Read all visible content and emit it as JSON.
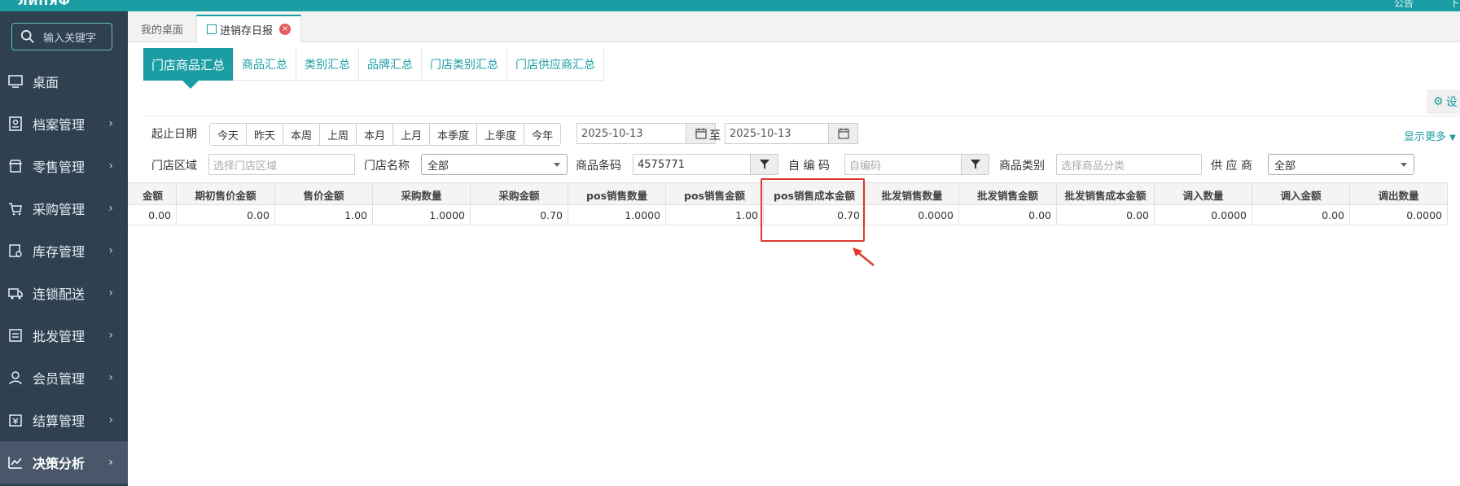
{
  "topbar": {
    "logo_fragment": "ЛИПЯФ",
    "notice": "公告",
    "right_fragment": "下"
  },
  "sidebar": {
    "search_placeholder": "输入关键字",
    "items": [
      {
        "label": "桌面",
        "icon": "desktop-icon",
        "has_arrow": false
      },
      {
        "label": "档案管理",
        "icon": "archive-icon",
        "has_arrow": true
      },
      {
        "label": "零售管理",
        "icon": "shop-icon",
        "has_arrow": true
      },
      {
        "label": "采购管理",
        "icon": "purchase-icon",
        "has_arrow": true
      },
      {
        "label": "库存管理",
        "icon": "inventory-icon",
        "has_arrow": true
      },
      {
        "label": "连锁配送",
        "icon": "delivery-icon",
        "has_arrow": true
      },
      {
        "label": "批发管理",
        "icon": "wholesale-icon",
        "has_arrow": true
      },
      {
        "label": "会员管理",
        "icon": "member-icon",
        "has_arrow": true
      },
      {
        "label": "结算管理",
        "icon": "settlement-icon",
        "has_arrow": true
      },
      {
        "label": "决策分析",
        "icon": "analytics-icon",
        "has_arrow": true,
        "active": true
      }
    ],
    "arrow": "›"
  },
  "tabs": {
    "home": "我的桌面",
    "active": "进销存日报",
    "close": "×"
  },
  "subtabs": [
    "门店商品汇总",
    "商品汇总",
    "类别汇总",
    "品牌汇总",
    "门店类别汇总",
    "门店供应商汇总"
  ],
  "settings_label": "设",
  "filters": {
    "date_label": "起止日期",
    "date_buttons": [
      "今天",
      "昨天",
      "本周",
      "上周",
      "本月",
      "上月",
      "本季度",
      "上季度",
      "今年"
    ],
    "date_from": "2025-10-13",
    "date_to_sep": "至",
    "date_to": "2025-10-13",
    "show_more": "显示更多",
    "region_label": "门店区域",
    "region_placeholder": "选择门店区域",
    "store_label": "门店名称",
    "store_value": "全部",
    "barcode_label": "商品条码",
    "barcode_value": "4575771",
    "selfcode_label": "自 编 码",
    "selfcode_placeholder": "自编码",
    "category_label": "商品类别",
    "category_placeholder": "选择商品分类",
    "supplier_label": "供 应 商",
    "supplier_value": "全部"
  },
  "table": {
    "columns": [
      "金额",
      "期初售价金额",
      "售价金额",
      "采购数量",
      "采购金额",
      "pos销售数量",
      "pos销售金额",
      "pos销售成本金额",
      "批发销售数量",
      "批发销售金额",
      "批发销售成本金额",
      "调入数量",
      "调入金额",
      "调出数量"
    ],
    "row": [
      "0.00",
      "0.00",
      "1.00",
      "1.0000",
      "0.70",
      "1.0000",
      "1.00",
      "0.70",
      "0.0000",
      "0.00",
      "0.00",
      "0.0000",
      "0.00",
      "0.0000"
    ]
  },
  "colors": {
    "accent": "#1a9ea3",
    "sidebar": "#2f4050",
    "annotation": "#e0392e"
  }
}
